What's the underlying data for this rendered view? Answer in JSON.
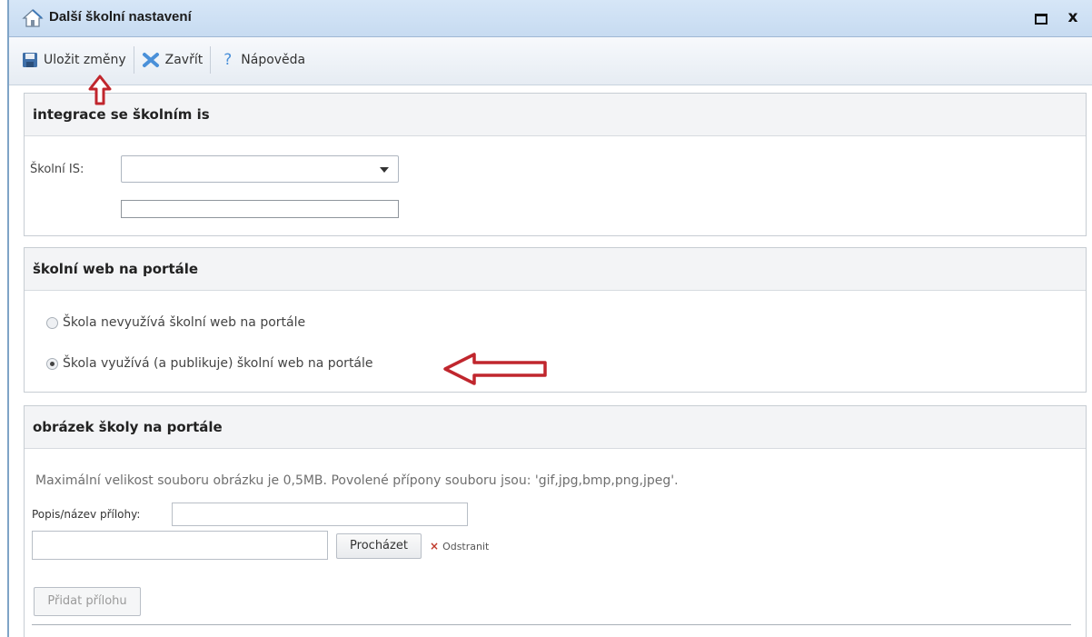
{
  "window": {
    "title": "Další školní nastavení",
    "close_glyph": "x"
  },
  "toolbar": {
    "save_label": "Uložit změny",
    "close_label": "Zavřít",
    "help_label": "Nápověda",
    "help_glyph": "?"
  },
  "integration": {
    "heading": "integrace se školním is",
    "school_is_label": "Školní IS:",
    "school_is_value": "",
    "extra_value": ""
  },
  "web": {
    "heading": "školní web na portále",
    "options": [
      {
        "label": "Škola nevyužívá školní web na portále",
        "checked": false
      },
      {
        "label": "Škola využívá (a publikuje) školní web na portále",
        "checked": true
      }
    ]
  },
  "image": {
    "heading": "obrázek školy na portále",
    "info": "Maximální velikost souboru obrázku je 0,5MB. Povolené přípony souboru jsou: 'gif,jpg,bmp,png,jpeg'.",
    "description_label": "Popis/název přílohy:",
    "description_value": "",
    "file_value": "",
    "browse_label": "Procházet",
    "remove_label": "Odstranit",
    "add_label": "Přidat přílohu"
  },
  "colors": {
    "annotation_arrow": "#c0262d",
    "titlebar": "#cfe1f5"
  }
}
